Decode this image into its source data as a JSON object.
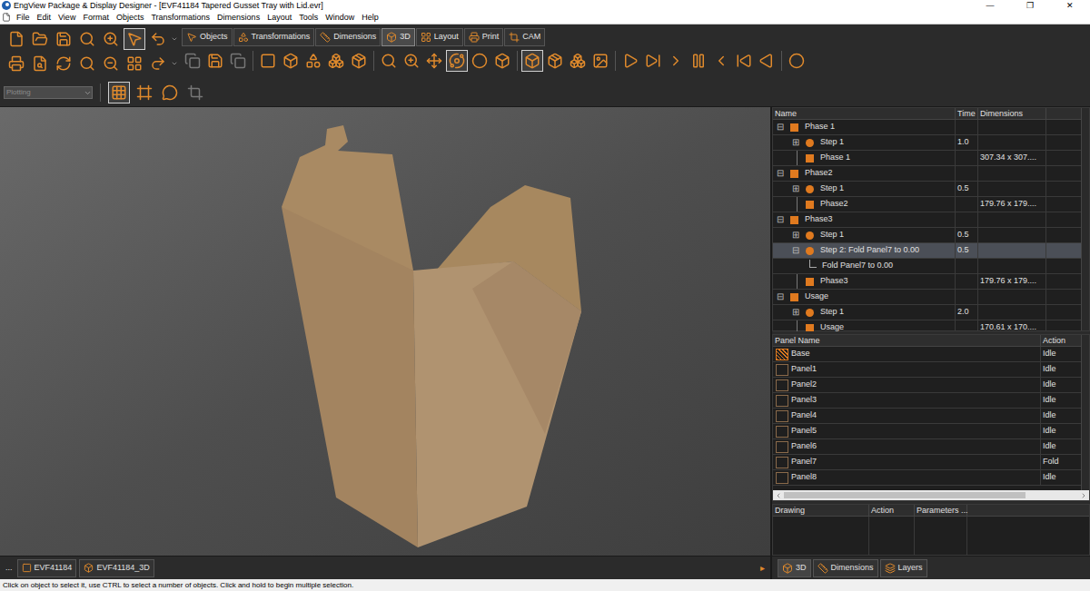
{
  "window": {
    "title": "EngView Package & Display Designer - [EVF41184 Tapered Gusset Tray with Lid.evr]",
    "controls": [
      "—",
      "❐",
      "✕"
    ]
  },
  "menu": [
    "File",
    "Edit",
    "View",
    "Format",
    "Objects",
    "Transformations",
    "Dimensions",
    "Layout",
    "Tools",
    "Window",
    "Help"
  ],
  "ribbon_tabs": [
    {
      "label": "Objects",
      "selected": false
    },
    {
      "label": "Transformations",
      "selected": false
    },
    {
      "label": "Dimensions",
      "selected": false
    },
    {
      "label": "3D",
      "selected": true
    },
    {
      "label": "Layout",
      "selected": false
    },
    {
      "label": "Print",
      "selected": false
    },
    {
      "label": "CAM",
      "selected": false
    }
  ],
  "plotting_dropdown": {
    "value": "Plotting",
    "disabled": true
  },
  "tree": {
    "columns": [
      "Name",
      "Time",
      "Dimensions"
    ],
    "rows": [
      {
        "toggle": "⊟",
        "name": "Phase 1",
        "time": "",
        "dimensions": "",
        "depth": 0,
        "kind": "phase",
        "selected": false
      },
      {
        "toggle": "⊞",
        "name": "Step 1",
        "time": "1.0",
        "dimensions": "",
        "depth": 1,
        "kind": "step",
        "selected": false
      },
      {
        "toggle": "",
        "name": "Phase 1",
        "time": "",
        "dimensions": "307.34 x 307....",
        "depth": 1,
        "kind": "phase",
        "selected": false
      },
      {
        "toggle": "⊟",
        "name": "Phase2",
        "time": "",
        "dimensions": "",
        "depth": 0,
        "kind": "phase",
        "selected": false
      },
      {
        "toggle": "⊞",
        "name": "Step 1",
        "time": "0.5",
        "dimensions": "",
        "depth": 1,
        "kind": "step",
        "selected": false
      },
      {
        "toggle": "",
        "name": "Phase2",
        "time": "",
        "dimensions": "179.76 x 179....",
        "depth": 1,
        "kind": "phase",
        "selected": false
      },
      {
        "toggle": "⊟",
        "name": "Phase3",
        "time": "",
        "dimensions": "",
        "depth": 0,
        "kind": "phase",
        "selected": false
      },
      {
        "toggle": "⊞",
        "name": "Step 1",
        "time": "0.5",
        "dimensions": "",
        "depth": 1,
        "kind": "step",
        "selected": false
      },
      {
        "toggle": "⊟",
        "name": "Step 2: Fold Panel7 to 0.00",
        "time": "0.5",
        "dimensions": "",
        "depth": 1,
        "kind": "step",
        "selected": true
      },
      {
        "toggle": "",
        "name": "Fold Panel7 to 0.00",
        "time": "",
        "dimensions": "",
        "depth": 2,
        "kind": "action",
        "selected": false
      },
      {
        "toggle": "",
        "name": "Phase3",
        "time": "",
        "dimensions": "179.76 x 179....",
        "depth": 1,
        "kind": "phase",
        "selected": false
      },
      {
        "toggle": "⊟",
        "name": "Usage",
        "time": "",
        "dimensions": "",
        "depth": 0,
        "kind": "phase",
        "selected": false
      },
      {
        "toggle": "⊞",
        "name": "Step 1",
        "time": "2.0",
        "dimensions": "",
        "depth": 1,
        "kind": "step",
        "selected": false
      },
      {
        "toggle": "",
        "name": "Usage",
        "time": "",
        "dimensions": "170.61 x 170....",
        "depth": 1,
        "kind": "phase",
        "selected": false
      }
    ]
  },
  "panels": {
    "columns": [
      "Panel Name",
      "Action"
    ],
    "rows": [
      {
        "name": "Base",
        "action": "Idle",
        "kind": "base"
      },
      {
        "name": "Panel1",
        "action": "Idle",
        "kind": "panel"
      },
      {
        "name": "Panel2",
        "action": "Idle",
        "kind": "panel"
      },
      {
        "name": "Panel3",
        "action": "Idle",
        "kind": "panel"
      },
      {
        "name": "Panel4",
        "action": "Idle",
        "kind": "panel"
      },
      {
        "name": "Panel5",
        "action": "Idle",
        "kind": "panel"
      },
      {
        "name": "Panel6",
        "action": "Idle",
        "kind": "panel"
      },
      {
        "name": "Panel7",
        "action": "Fold",
        "kind": "panel"
      },
      {
        "name": "Panel8",
        "action": "Idle",
        "kind": "panel"
      }
    ]
  },
  "drawing_table": {
    "columns": [
      "Drawing",
      "Action",
      "Parameters ..."
    ]
  },
  "doc_tabs": {
    "more": "...",
    "tabs": [
      "EVF41184",
      "EVF41184_3D"
    ],
    "scroll": "▸"
  },
  "panel_tabs": [
    "3D",
    "Dimensions",
    "Layers"
  ],
  "status_bar": "Click on object to select it, use CTRL to select a number of objects. Click and hold to begin multiple selection."
}
